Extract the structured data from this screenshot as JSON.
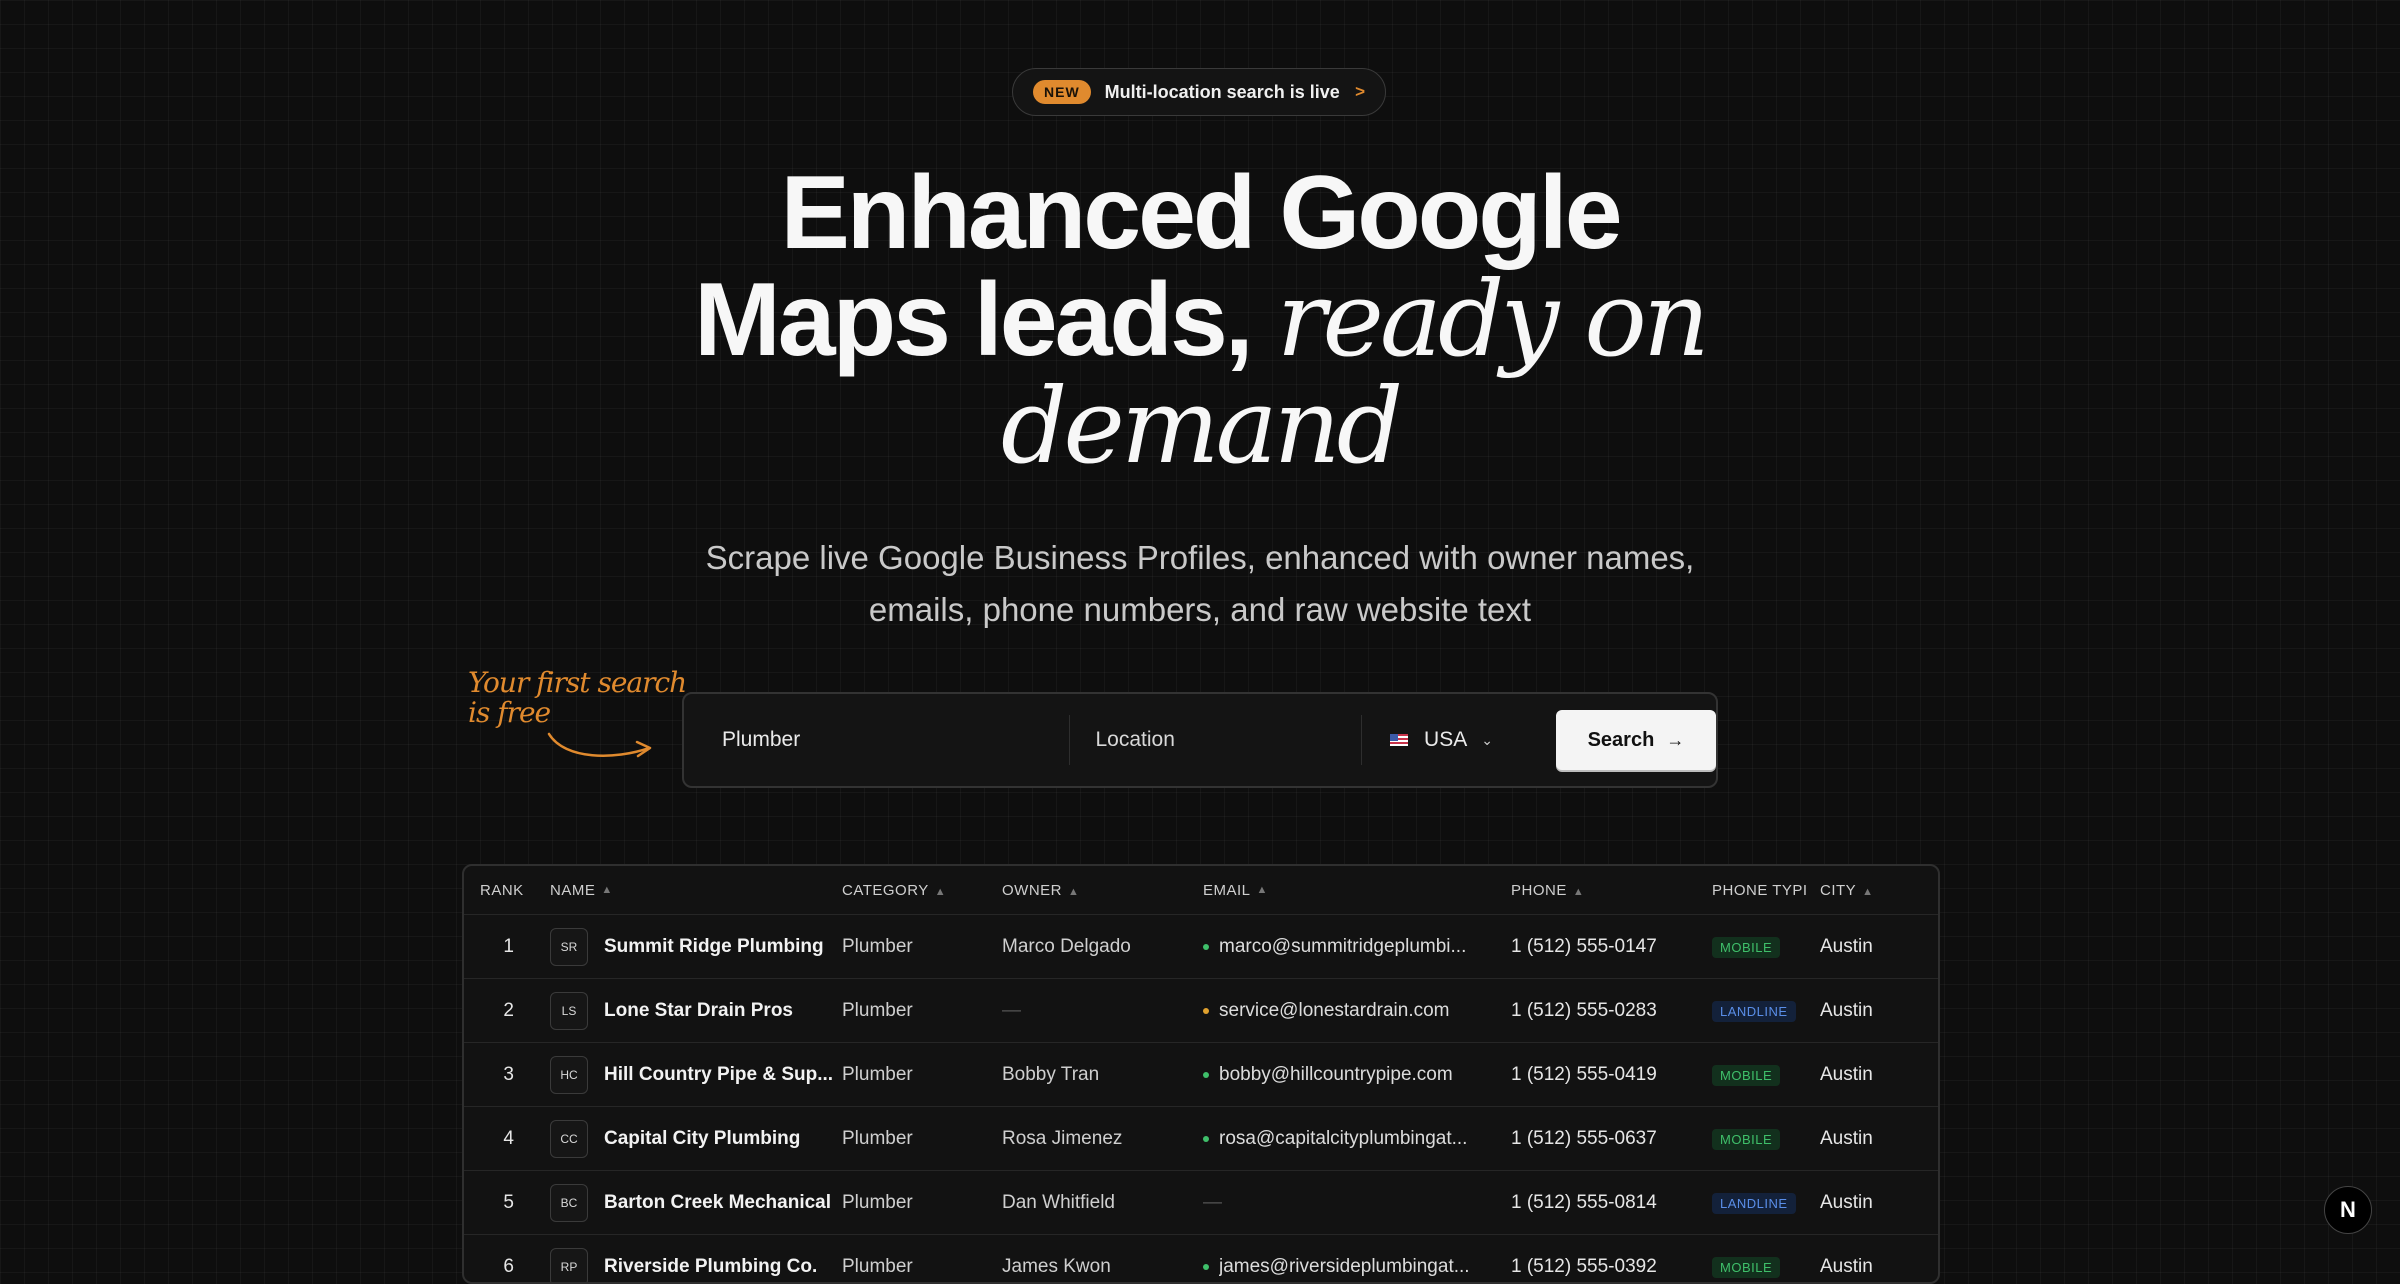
{
  "announcement": {
    "badge": "NEW",
    "text": "Multi-location search is live",
    "chevron": ">"
  },
  "hero": {
    "line1": "Enhanced Google",
    "line2_plain": "Maps leads,",
    "line2_italic": "ready on",
    "line3_italic": "demand"
  },
  "subtitle": {
    "line1": "Scrape live Google Business Profiles, enhanced with owner names,",
    "line2": "emails, phone numbers, and raw website text"
  },
  "hint": {
    "line1": "Your first search",
    "line2": "is free"
  },
  "search": {
    "keyword_value": "Plumber",
    "location_placeholder": "Location",
    "country": "USA",
    "button_label": "Search",
    "button_icon": "arrow-right-icon"
  },
  "table": {
    "headers": {
      "rank": "RANK",
      "name": "NAME",
      "category": "CATEGORY",
      "owner": "OWNER",
      "email": "EMAIL",
      "phone": "PHONE",
      "phone_type": "PHONE TYPI",
      "city": "CITY"
    },
    "rows": [
      {
        "rank": "1",
        "initials": "SR",
        "name": "Summit Ridge Plumbing",
        "category": "Plumber",
        "owner": "Marco Delgado",
        "email": "marco@summitridgeplumbi...",
        "email_status": "valid",
        "phone": "1 (512) 555-0147",
        "phone_type": "MOBILE",
        "city": "Austin"
      },
      {
        "rank": "2",
        "initials": "LS",
        "name": "Lone Star Drain Pros",
        "category": "Plumber",
        "owner": "—",
        "email": "service@lonestardrain.com",
        "email_status": "risky",
        "phone": "1 (512) 555-0283",
        "phone_type": "LANDLINE",
        "city": "Austin"
      },
      {
        "rank": "3",
        "initials": "HC",
        "name": "Hill Country Pipe & Sup...",
        "category": "Plumber",
        "owner": "Bobby Tran",
        "email": "bobby@hillcountrypipe.com",
        "email_status": "valid",
        "phone": "1 (512) 555-0419",
        "phone_type": "MOBILE",
        "city": "Austin"
      },
      {
        "rank": "4",
        "initials": "CC",
        "name": "Capital City Plumbing",
        "category": "Plumber",
        "owner": "Rosa Jimenez",
        "email": "rosa@capitalcityplumbingat...",
        "email_status": "valid",
        "phone": "1 (512) 555-0637",
        "phone_type": "MOBILE",
        "city": "Austin"
      },
      {
        "rank": "5",
        "initials": "BC",
        "name": "Barton Creek Mechanical",
        "category": "Plumber",
        "owner": "Dan Whitfield",
        "email": "—",
        "email_status": "none",
        "phone": "1 (512) 555-0814",
        "phone_type": "LANDLINE",
        "city": "Austin"
      },
      {
        "rank": "6",
        "initials": "RP",
        "name": "Riverside Plumbing Co.",
        "category": "Plumber",
        "owner": "James Kwon",
        "email": "james@riversideplumbingat...",
        "email_status": "valid",
        "phone": "1 (512) 555-0392",
        "phone_type": "MOBILE",
        "city": "Austin"
      }
    ]
  },
  "colors": {
    "accent": "#e08a2e",
    "valid": "#3fbf6a",
    "risky": "#e0a12e",
    "mobile": "#3fbf6a",
    "landline": "#5a8ee8"
  },
  "corner_button": {
    "label": "N"
  }
}
